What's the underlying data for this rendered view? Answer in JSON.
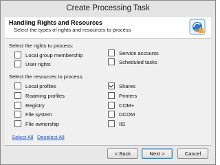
{
  "window": {
    "title": "Create Processing Task"
  },
  "header": {
    "title": "Handling Rights and Resources",
    "subtitle": "Select the types of rights and resources to process",
    "icon": "task-wizard-icon"
  },
  "rights_section": {
    "label": "Select the rights to process:",
    "items": [
      {
        "label": "Local group membership",
        "checked": false
      },
      {
        "label": "User rights",
        "checked": false
      },
      {
        "label": "Service accounts",
        "checked": false
      },
      {
        "label": "Scheduled tasks",
        "checked": false
      }
    ]
  },
  "resources_section": {
    "label": "Select the resources to process:",
    "items": [
      {
        "label": "Local profiles",
        "checked": false
      },
      {
        "label": "Roaming profiles",
        "checked": false
      },
      {
        "label": "Registry",
        "checked": false
      },
      {
        "label": "File system",
        "checked": false
      },
      {
        "label": "File ownership",
        "checked": false
      },
      {
        "label": "Shares",
        "checked": true
      },
      {
        "label": "Printers",
        "checked": false
      },
      {
        "label": "COM+",
        "checked": false
      },
      {
        "label": "DCOM",
        "checked": false
      },
      {
        "label": "IIS",
        "checked": false
      }
    ]
  },
  "links": {
    "select_all": "Select All",
    "deselect_all": "Deselect All"
  },
  "buttons": {
    "back": "< Back",
    "next": "Next >",
    "cancel": "Cancel"
  }
}
